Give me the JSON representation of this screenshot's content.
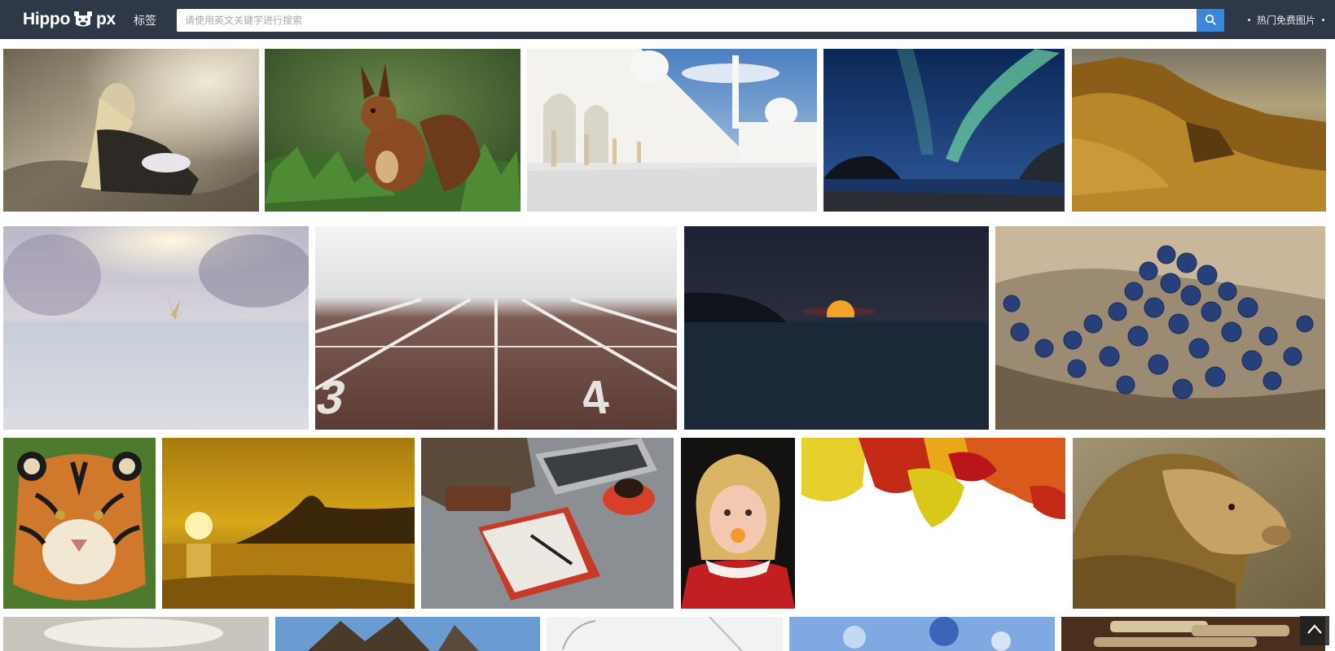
{
  "header": {
    "logo_left": "Hippo",
    "logo_right": "px",
    "nav_tag_label": "标签",
    "search_placeholder": "请使用英文关键字进行搜索",
    "hot_link_label": "热门免费图片"
  },
  "icons": {
    "logo": "hippo-icon",
    "search": "search-icon",
    "scroll_top": "chevron-up-icon"
  },
  "colors": {
    "header_bg": "#2f3847",
    "search_button": "#3c87d9",
    "page_bg": "#ffffff"
  },
  "gallery": {
    "rows": [
      {
        "items": [
          "girl-sitting-in-grass",
          "red-squirrel-on-pine",
          "white-mosque-arcade",
          "aurora-over-sea",
          "golden-cliffs-landscape"
        ]
      },
      {
        "items": [
          "frosty-blurred-field",
          "running-track-lanes",
          "sunset-over-dark-sea",
          "blueberries-on-wood"
        ]
      },
      {
        "items": [
          "bengal-tiger-face",
          "golden-beach-sunset",
          "desk-with-laptop-and-notebook",
          "little-girl-red-dress",
          "autumn-leaves-border",
          "lion-profile"
        ]
      },
      {
        "items": [
          "cloudy-sky",
          "sea-blue-sky",
          "white-abstract",
          "blue-crystals",
          "stacked-items"
        ]
      }
    ]
  }
}
